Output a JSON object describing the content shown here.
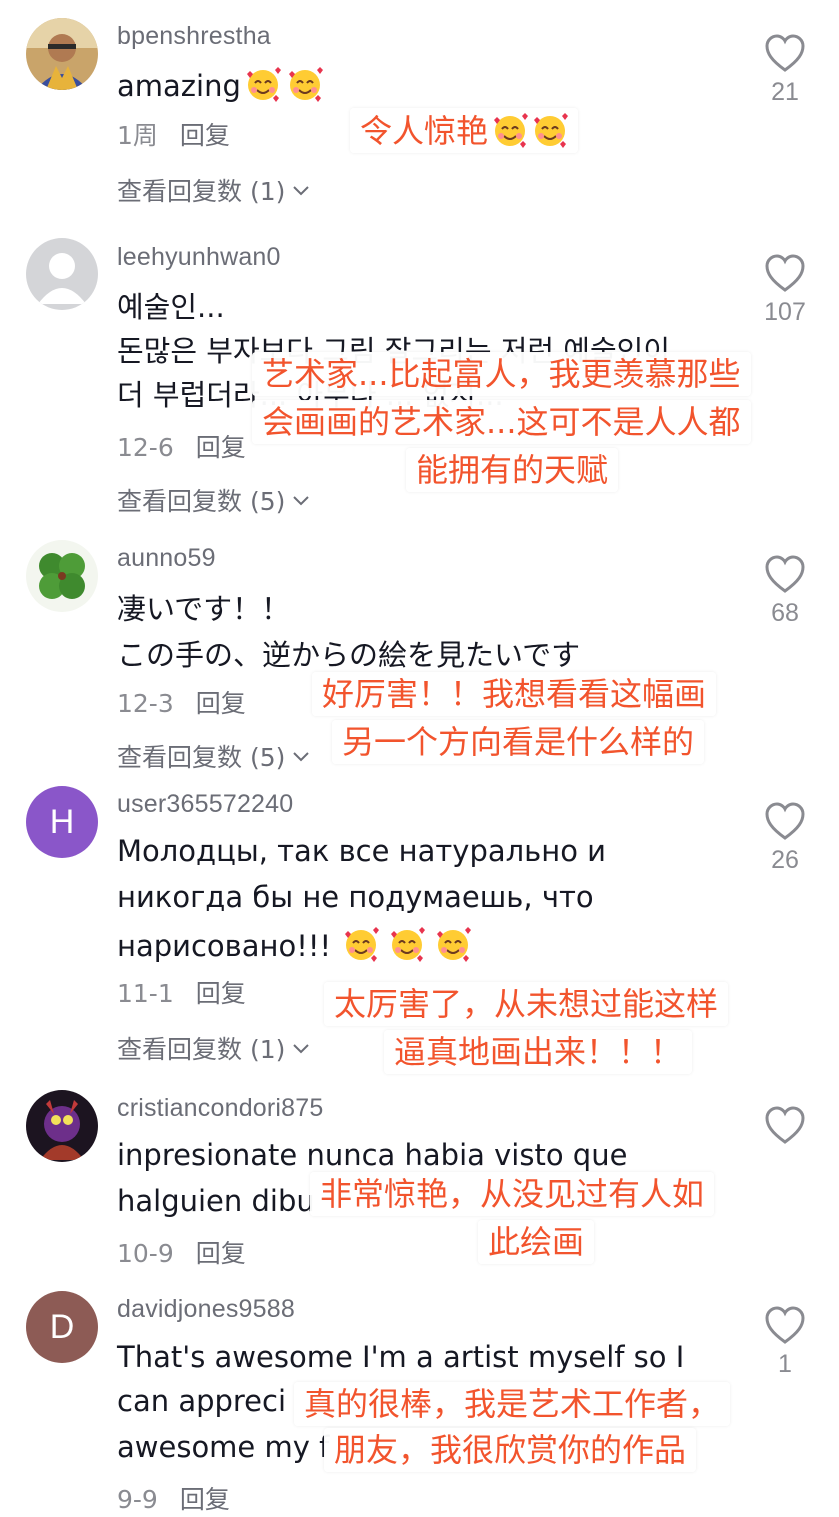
{
  "comments": [
    {
      "username": "bpenshrestha",
      "lines": [
        "amazing"
      ],
      "date": "1周",
      "reply": "回复",
      "view_replies": "查看回复数 (1)",
      "likes": "21",
      "translation": [
        "令人惊艳"
      ]
    },
    {
      "username": "leehyunhwan0",
      "lines": [
        "예술인...",
        "돈많은 부자보다 그림 잘그리는 저런 예술인이",
        "더 부럽더라... 아무나 ... 없지..."
      ],
      "date": "12-6",
      "reply": "回复",
      "view_replies": "查看回复数 (5)",
      "likes": "107",
      "translation": [
        "艺术家...比起富人，我更羡慕那些",
        "会画画的艺术家...这可不是人人都",
        "能拥有的天赋"
      ]
    },
    {
      "username": "aunno59",
      "lines": [
        "凄いです！！",
        "この手の、逆からの絵を見たいです"
      ],
      "date": "12-3",
      "reply": "回复",
      "view_replies": "查看回复数 (5)",
      "likes": "68",
      "translation": [
        "好厉害！！我想看看这幅画",
        "另一个方向看是什么样的"
      ]
    },
    {
      "username": "user365572240",
      "avatar_letter": "H",
      "lines": [
        "Молодцы, так все натурально и",
        "никогда бы не подумаешь, что",
        "нарисовано!!!"
      ],
      "date": "11-1",
      "reply": "回复",
      "view_replies": "查看回复数 (1)",
      "likes": "26",
      "translation": [
        "太厉害了，从未想过能这样",
        "逼真地画出来！！！"
      ]
    },
    {
      "username": "cristiancondori875",
      "lines": [
        "inpresionate nunca habia visto que",
        "halguien dibu"
      ],
      "date": "10-9",
      "reply": "回复",
      "likes": "",
      "translation": [
        "非常惊艳，从没见过有人如",
        "此绘画"
      ]
    },
    {
      "username": "davidjones9588",
      "avatar_letter": "D",
      "lines": [
        "That's awesome I'm a artist myself so I",
        "can appreci",
        "awesome my f"
      ],
      "date": "9-9",
      "reply": "回复",
      "likes": "1",
      "translation": [
        "真的很棒，我是艺术工作者，",
        "朋友，我很欣赏你的作品"
      ]
    }
  ],
  "colors": {
    "translation_text": "#f2542d",
    "username": "#6b6d76",
    "avatar_h": "#8a56c9",
    "avatar_d": "#8d5b55"
  },
  "icons": {
    "like": "heart-outline-icon",
    "expand": "chevron-down-icon",
    "emoji": "smiling-face-with-hearts-emoji"
  }
}
